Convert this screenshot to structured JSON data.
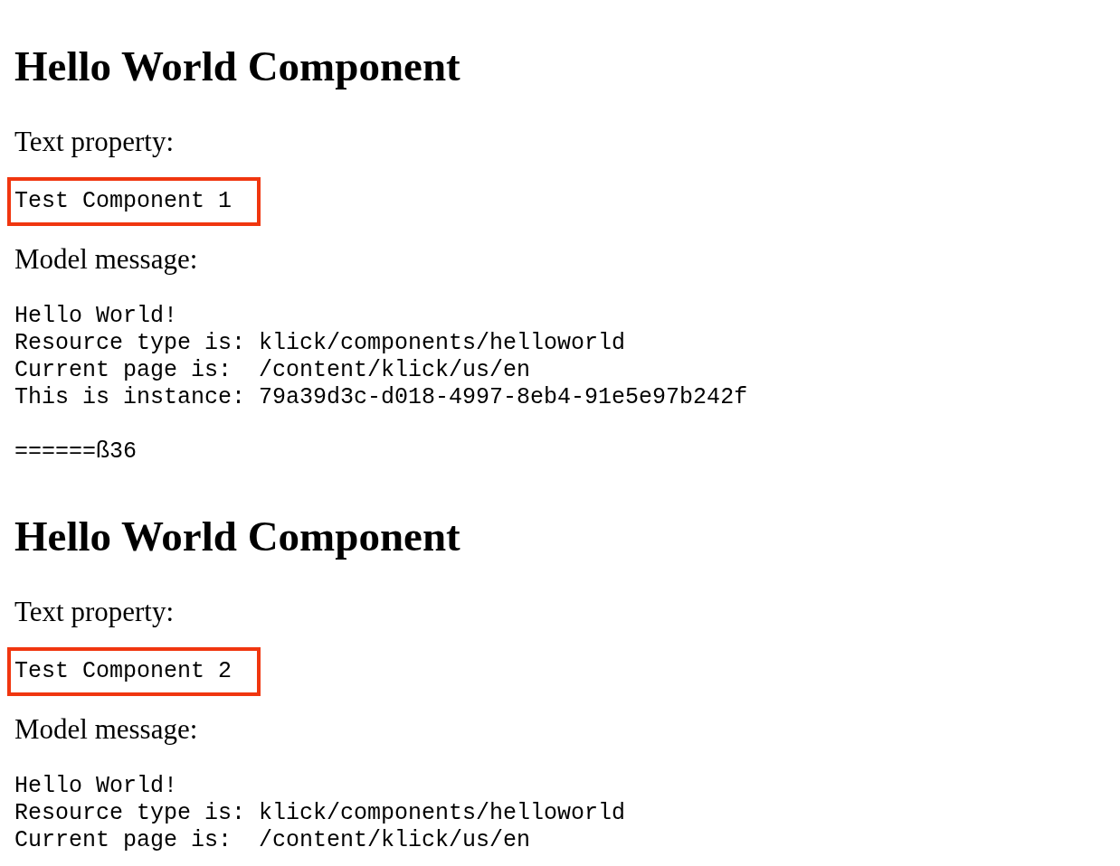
{
  "components": [
    {
      "title": "Hello World Component",
      "text_label": "Text property:",
      "text_value": "Test Component 1",
      "highlighted": true,
      "message_label": "Model message:",
      "message_lines": [
        "Hello World!",
        "Resource type is: klick/components/helloworld",
        "Current page is:  /content/klick/us/en",
        "This is instance: 79a39d3c-d018-4997-8eb4-91e5e97b242f"
      ],
      "footer": "======ß36"
    },
    {
      "title": "Hello World Component",
      "text_label": "Text property:",
      "text_value": "Test Component 2",
      "highlighted": true,
      "message_label": "Model message:",
      "message_lines": [
        "Hello World!",
        "Resource type is: klick/components/helloworld",
        "Current page is:  /content/klick/us/en"
      ]
    }
  ]
}
